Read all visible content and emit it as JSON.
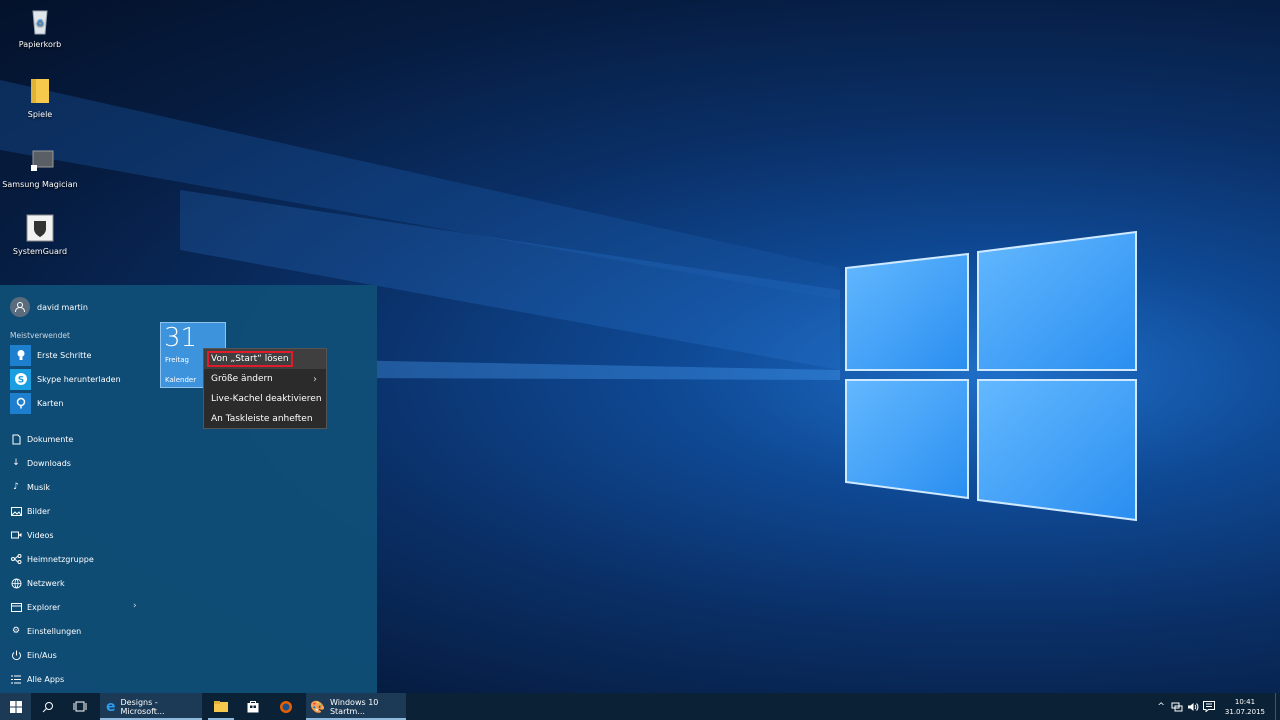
{
  "desktop": {
    "icons": [
      {
        "label": "Papierkorb"
      },
      {
        "label": "Spiele"
      },
      {
        "label": "Samsung Magician"
      },
      {
        "label": "SystemGuard"
      }
    ]
  },
  "start_menu": {
    "user_name": "david martin",
    "most_used_label": "Meistverwendet",
    "apps": [
      {
        "label": "Erste Schritte",
        "icon": "lightbulb-icon"
      },
      {
        "label": "Skype herunterladen",
        "icon": "skype-icon"
      },
      {
        "label": "Karten",
        "icon": "maps-icon"
      }
    ],
    "places": [
      {
        "label": "Dokumente",
        "icon": "document-icon"
      },
      {
        "label": "Downloads",
        "icon": "download-icon"
      },
      {
        "label": "Musik",
        "icon": "music-icon"
      },
      {
        "label": "Bilder",
        "icon": "pictures-icon"
      },
      {
        "label": "Videos",
        "icon": "video-icon"
      },
      {
        "label": "Heimnetzgruppe",
        "icon": "homegroup-icon"
      },
      {
        "label": "Netzwerk",
        "icon": "network-icon"
      },
      {
        "label": "Explorer",
        "icon": "explorer-icon"
      },
      {
        "label": "Einstellungen",
        "icon": "settings-icon"
      },
      {
        "label": "Ein/Aus",
        "icon": "power-icon"
      },
      {
        "label": "Alle Apps",
        "icon": "all-apps-icon"
      }
    ],
    "tile": {
      "number": "31",
      "day": "Freitag",
      "name": "Kalender"
    }
  },
  "context_menu": {
    "items": [
      {
        "label": "Von „Start“ lösen"
      },
      {
        "label": "Größe ändern"
      },
      {
        "label": "Live-Kachel deaktivieren"
      },
      {
        "label": "An Taskleiste anheften"
      }
    ]
  },
  "taskbar": {
    "apps": [
      {
        "label": "Designs - Microsoft..."
      },
      {
        "label": "Windows 10 Startm..."
      }
    ],
    "time": "10:41",
    "date": "31.07.2015"
  },
  "colors": {
    "accent": "#1f7fcf",
    "highlight_border": "#e01c2c"
  }
}
